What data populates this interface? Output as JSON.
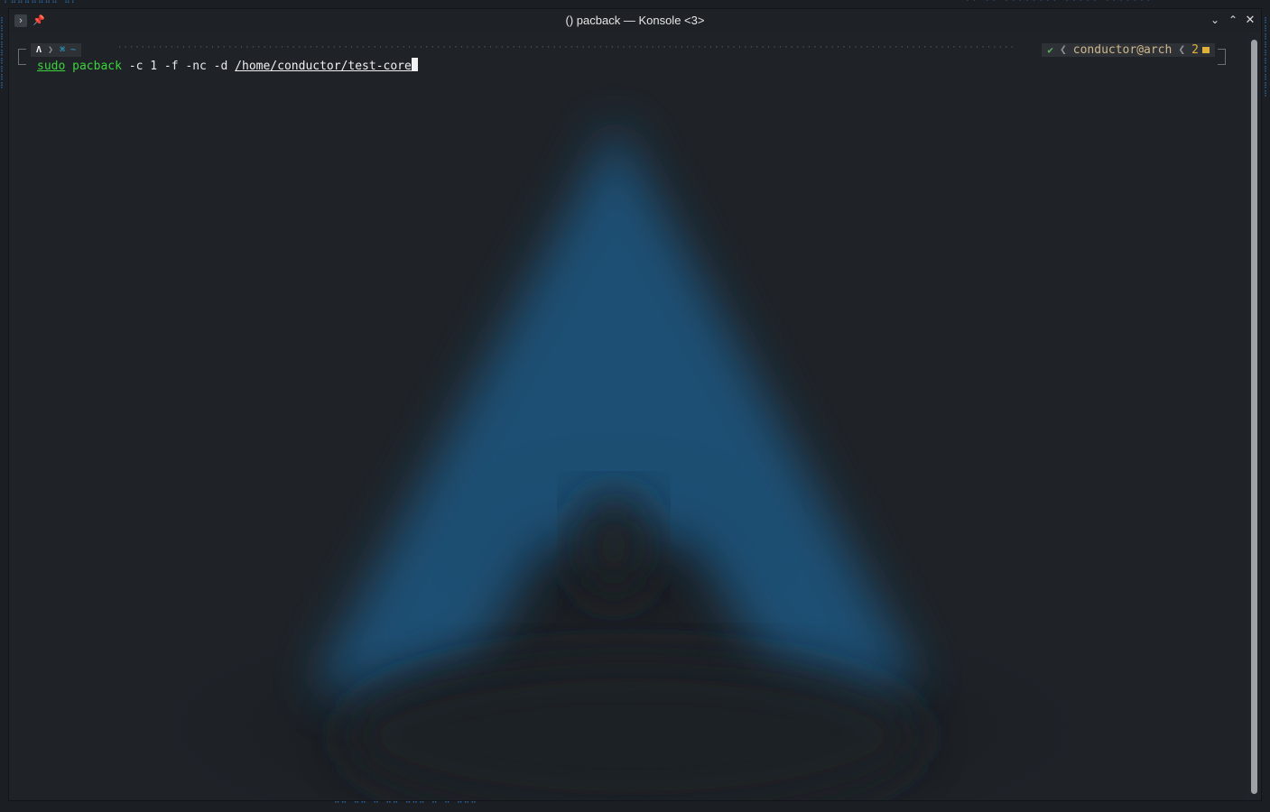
{
  "window": {
    "title": "() pacback — Konsole <3>",
    "icons": [
      "terminal-icon",
      "pin-icon",
      "chevron-down-icon",
      "chevron-up-icon",
      "close-icon"
    ],
    "buttons": {
      "minimize": "⌄",
      "maximize": "⌃",
      "close": "✕"
    }
  },
  "prompt": {
    "os_icon": "Λ",
    "separator": "❯",
    "dir_symbol": "⌘ ~",
    "status_ok": "✔",
    "context": "conductor@arch",
    "jobs": "2",
    "left_angle": "❮"
  },
  "command": {
    "sudo": "sudo",
    "program": "pacback",
    "args": " -c 1 -f -nc -d ",
    "path": "/home/conductor/test-core"
  },
  "colors": {
    "accent_green": "#3cd33c",
    "context_tan": "#d0b78a",
    "jobs_yellow": "#e0b13a",
    "arch_blue": "#1f5a86"
  }
}
